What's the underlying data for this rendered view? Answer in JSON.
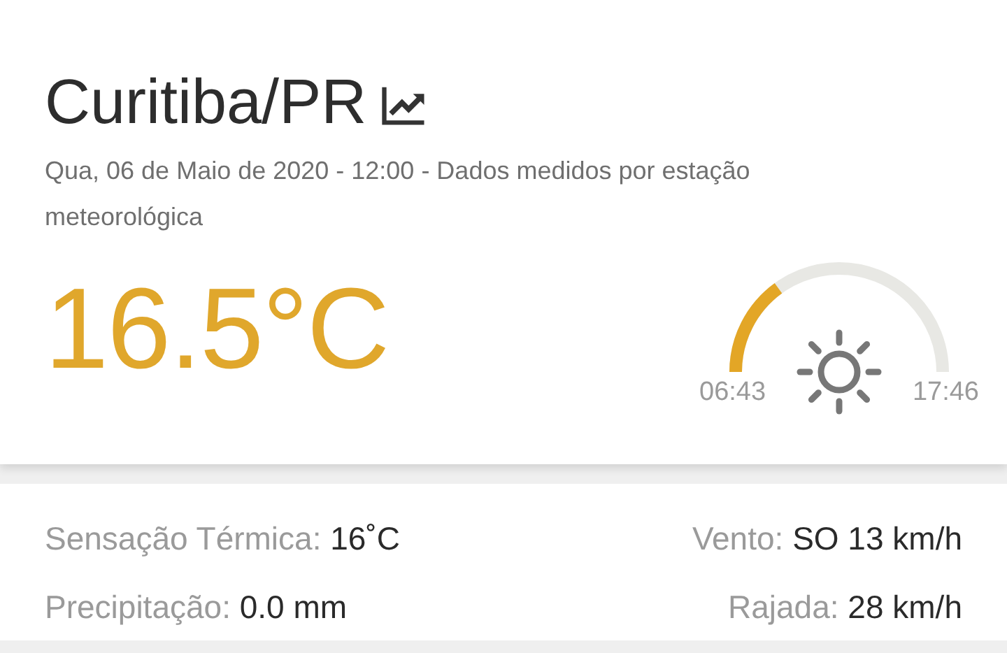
{
  "location": {
    "title": "Curitiba/PR"
  },
  "subtitle": "Qua, 06 de Maio de 2020 - 12:00 - Dados medidos por estação meteorológica",
  "temperature": "16.5°C",
  "sun": {
    "sunrise": "06:43",
    "sunset": "17:46"
  },
  "details": [
    {
      "label": "Sensação Térmica:",
      "value": "16˚C"
    },
    {
      "label": "Vento:",
      "value": "SO 13 km/h"
    },
    {
      "label": "Precipitação:",
      "value": "0.0 mm"
    },
    {
      "label": "Rajada:",
      "value": "28 km/h"
    }
  ]
}
